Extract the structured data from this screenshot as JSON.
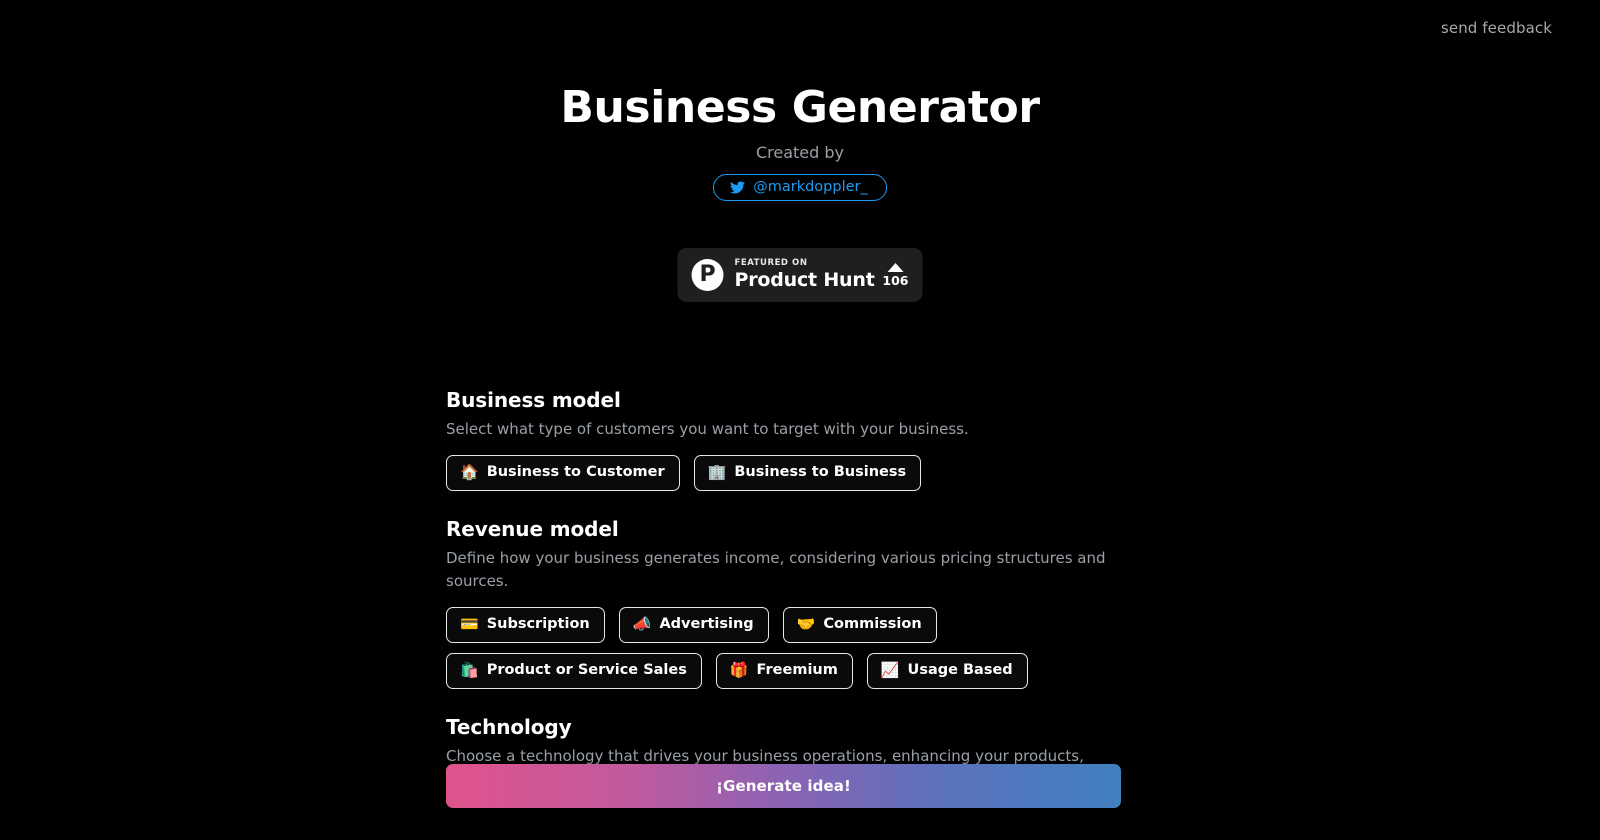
{
  "topbar": {
    "feedback_label": "send feedback"
  },
  "hero": {
    "title": "Business Generator",
    "created_by_label": "Created by",
    "author_handle": "@markdoppler_",
    "twitter_icon": "twitter-bird-icon"
  },
  "product_hunt": {
    "logo_letter": "P",
    "featured_label": "FEATURED ON",
    "product_name": "Product Hunt",
    "upvote_count": "106",
    "upvote_icon": "caret-up-icon"
  },
  "sections": [
    {
      "title": "Business model",
      "description": "Select what type of customers you want to target with your business.",
      "options": [
        {
          "emoji": "🏠",
          "icon_name": "house-icon",
          "label": "Business to Customer"
        },
        {
          "emoji": "🏢",
          "icon_name": "office-building-icon",
          "label": "Business to Business"
        }
      ]
    },
    {
      "title": "Revenue model",
      "description": "Define how your business generates income, considering various pricing structures and sources.",
      "options": [
        {
          "emoji": "💳",
          "icon_name": "credit-card-icon",
          "label": "Subscription"
        },
        {
          "emoji": "📣",
          "icon_name": "megaphone-icon",
          "label": "Advertising"
        },
        {
          "emoji": "🤝",
          "icon_name": "handshake-icon",
          "label": "Commission"
        },
        {
          "emoji": "🛍️",
          "icon_name": "shopping-bags-icon",
          "label": "Product or Service Sales"
        },
        {
          "emoji": "🎁",
          "icon_name": "gift-icon",
          "label": "Freemium"
        },
        {
          "emoji": "📈",
          "icon_name": "chart-increasing-icon",
          "label": "Usage Based"
        }
      ]
    },
    {
      "title": "Technology",
      "description": "Choose a technology that drives your business operations, enhancing your products, services, and competitive edge.",
      "options": []
    }
  ],
  "cta": {
    "label": "¡Generate idea!",
    "gradient_from": "#e0538c",
    "gradient_to": "#4180be"
  },
  "theme": {
    "background": "#000000",
    "accent_blue": "#1d9bf0",
    "muted_text": "#9aa0a6",
    "border": "#e6e6e6"
  }
}
